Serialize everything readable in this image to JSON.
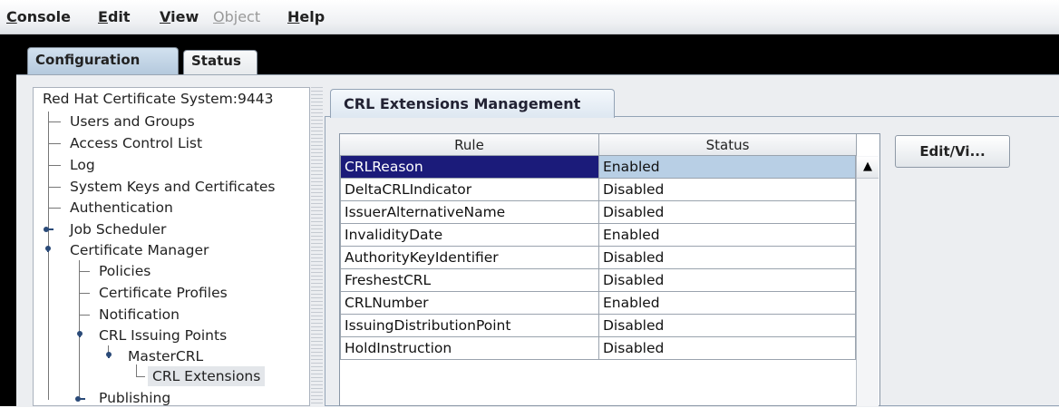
{
  "menubar": {
    "items": [
      {
        "label": "Console",
        "acc": "C",
        "rest": "onsole",
        "disabled": false
      },
      {
        "label": "Edit",
        "acc": "E",
        "rest": "dit",
        "disabled": false
      },
      {
        "label": "View",
        "acc": "V",
        "rest": "iew",
        "disabled": false
      },
      {
        "label": "Object",
        "acc": "O",
        "rest": "bject",
        "disabled": true
      },
      {
        "label": "Help",
        "acc": "H",
        "rest": "elp",
        "disabled": false
      }
    ]
  },
  "main_tabs": [
    {
      "label": "Configuration",
      "selected": true
    },
    {
      "label": "Status",
      "selected": false
    }
  ],
  "tree": {
    "root": "Red Hat Certificate System:9443",
    "nodes": [
      {
        "label": "Users and Groups"
      },
      {
        "label": "Access Control List"
      },
      {
        "label": "Log"
      },
      {
        "label": "System Keys and Certificates"
      },
      {
        "label": "Authentication"
      },
      {
        "label": "Job Scheduler",
        "expandable": true,
        "expanded": false
      },
      {
        "label": "Certificate Manager",
        "expandable": true,
        "expanded": true
      },
      {
        "label": "Policies"
      },
      {
        "label": "Certificate Profiles"
      },
      {
        "label": "Notification"
      },
      {
        "label": "CRL Issuing Points",
        "expandable": true,
        "expanded": true
      },
      {
        "label": "MasterCRL",
        "expandable": true,
        "expanded": true
      },
      {
        "label": "CRL Extensions",
        "selected": true
      },
      {
        "label": "Publishing",
        "expandable": true,
        "expanded": false
      }
    ]
  },
  "panel": {
    "tab_label": "CRL Extensions Management",
    "table": {
      "columns": [
        "Rule",
        "Status"
      ],
      "rows": [
        {
          "rule": "CRLReason",
          "status": "Enabled",
          "selected": true
        },
        {
          "rule": "DeltaCRLIndicator",
          "status": "Disabled"
        },
        {
          "rule": "IssuerAlternativeName",
          "status": "Disabled"
        },
        {
          "rule": "InvalidityDate",
          "status": "Enabled"
        },
        {
          "rule": "AuthorityKeyIdentifier",
          "status": "Disabled"
        },
        {
          "rule": "FreshestCRL",
          "status": "Disabled"
        },
        {
          "rule": "CRLNumber",
          "status": "Enabled"
        },
        {
          "rule": "IssuingDistributionPoint",
          "status": "Disabled"
        },
        {
          "rule": "HoldInstruction",
          "status": "Disabled"
        }
      ]
    },
    "edit_button_label": "Edit/Vi..."
  },
  "colors": {
    "selection_dark": "#1b1b7a",
    "selection_light": "#b8cfe5",
    "tab_selected": "#b5c9dd"
  }
}
